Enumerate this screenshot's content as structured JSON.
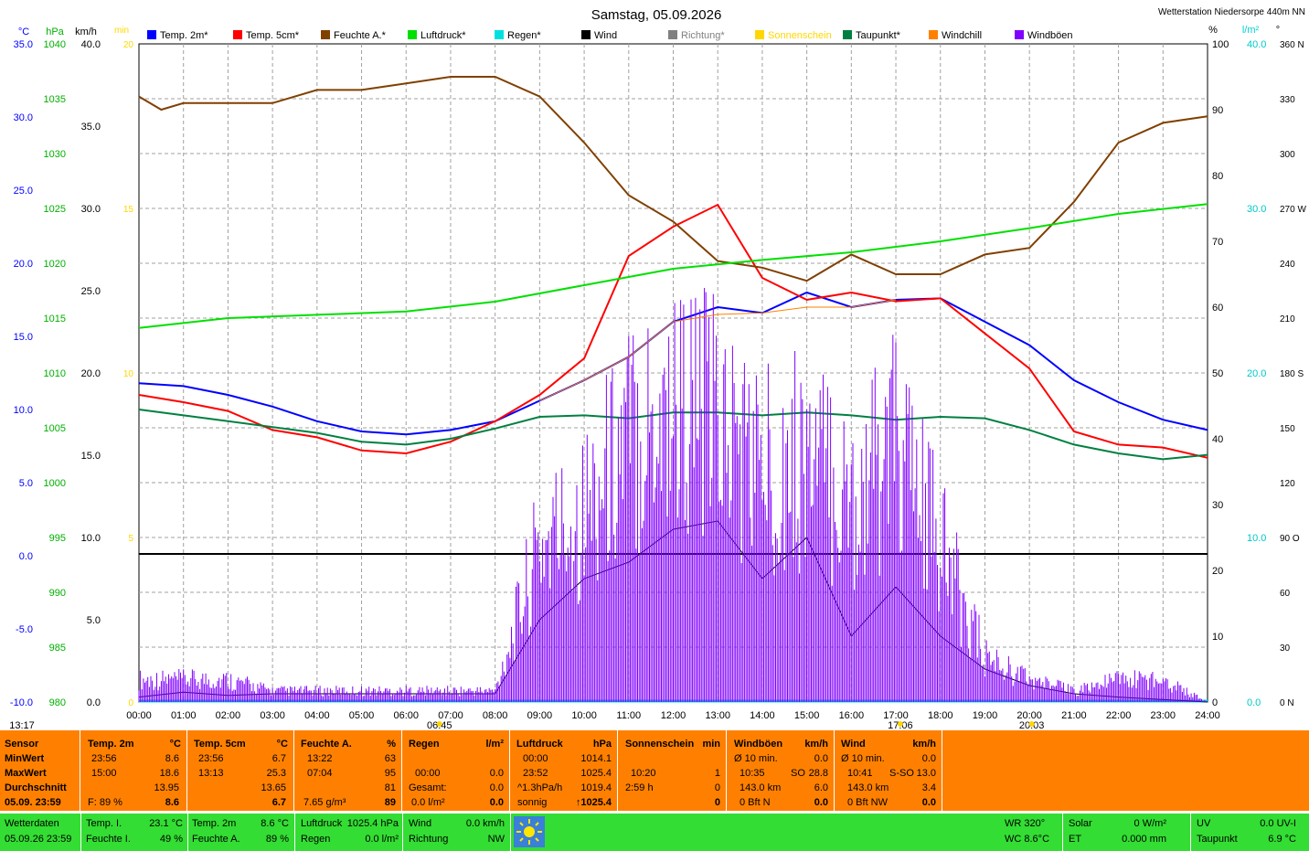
{
  "header": {
    "title": "Samstag, 05.09.2026",
    "station": "Wetterstation Niedersorpe 440m NN"
  },
  "legend": [
    {
      "name": "Temp. 2m*",
      "color": "#0000ff"
    },
    {
      "name": "Temp. 5cm*",
      "color": "#ff0000"
    },
    {
      "name": "Feuchte A.*",
      "color": "#804000"
    },
    {
      "name": "Luftdruck*",
      "color": "#00e000"
    },
    {
      "name": "Regen*",
      "color": "#00e0e0"
    },
    {
      "name": "Wind",
      "color": "#000000"
    },
    {
      "name": "Richtung*",
      "color": "#808080"
    },
    {
      "name": "Sonnenschein",
      "color": "#ffd700"
    },
    {
      "name": "Taupunkt*",
      "color": "#008040"
    },
    {
      "name": "Windchill",
      "color": "#ff8000"
    },
    {
      "name": "Windböen",
      "color": "#8000ff"
    }
  ],
  "axes": {
    "unit_temp": "°C",
    "unit_press": "hPa",
    "unit_wind": "km/h",
    "unit_min": "min",
    "unit_pct": "%",
    "unit_rain": "l/m²",
    "unit_deg": "°",
    "temp": [
      "35.0",
      "30.0",
      "25.0",
      "20.0",
      "15.0",
      "10.0",
      "5.0",
      "0.0",
      "-5.0",
      "-10.0"
    ],
    "press": [
      "1040",
      "1035",
      "1030",
      "1025",
      "1020",
      "1015",
      "1010",
      "1005",
      "1000",
      "995",
      "990",
      "985",
      "980"
    ],
    "wind": [
      "40.0",
      "35.0",
      "30.0",
      "25.0",
      "20.0",
      "15.0",
      "10.0",
      "5.0",
      "0.0"
    ],
    "min": [
      "20",
      "15",
      "10",
      "5",
      "0"
    ],
    "pct": [
      "100",
      "90",
      "80",
      "70",
      "60",
      "50",
      "40",
      "30",
      "20",
      "10",
      "0"
    ],
    "rain": [
      "40.0",
      "30.0",
      "20.0",
      "10.0",
      "0.0"
    ],
    "deg": [
      "360 N",
      "330",
      "300",
      "270 W",
      "240",
      "210",
      "180 S",
      "150",
      "120",
      "90 O",
      "60",
      "30",
      "0 N"
    ],
    "x": [
      "00:00",
      "01:00",
      "02:00",
      "03:00",
      "04:00",
      "05:00",
      "06:00",
      "07:00",
      "08:00",
      "09:00",
      "10:00",
      "11:00",
      "12:00",
      "13:00",
      "14:00",
      "15:00",
      "16:00",
      "17:00",
      "18:00",
      "19:00",
      "20:00",
      "21:00",
      "22:00",
      "23:00",
      "24:00"
    ]
  },
  "markers": [
    {
      "label": "13:17",
      "hour": null
    },
    {
      "label": "06:45",
      "hour": 6.75
    },
    {
      "label": "17:06",
      "hour": 17.1
    },
    {
      "label": "20:03",
      "hour": 20.05
    }
  ],
  "stats": {
    "sensor": {
      "h": "Sensor",
      "min": "MinWert",
      "max": "MaxWert",
      "avg": "Durchschnitt",
      "date": "05.09. 23:59"
    },
    "temp2m": {
      "h": "Temp. 2m",
      "u": "°C",
      "min_t": "23:56",
      "min_v": "8.6",
      "max_t": "15:00",
      "max_v": "18.6",
      "avg": "13.95",
      "now_l": "F: 89 %",
      "now": "8.6"
    },
    "temp5cm": {
      "h": "Temp. 5cm",
      "u": "°C",
      "min_t": "23:56",
      "min_v": "6.7",
      "max_t": "13:13",
      "max_v": "25.3",
      "avg": "13.65",
      "now": "6.7"
    },
    "feuchte": {
      "h": "Feuchte A.",
      "u": "%",
      "min_t": "13:22",
      "min_v": "63",
      "max_t": "07:04",
      "max_v": "95",
      "avg": "81",
      "now_l": "7.65 g/m³",
      "now": "89"
    },
    "regen": {
      "h": "Regen",
      "u": "l/m²",
      "r1_t": "00:00",
      "r1_v": "0.0",
      "r2_l": "Gesamt:",
      "r2_v": "0.0",
      "r3_l": "0.0 l/m²",
      "now": "0.0"
    },
    "luftdruck": {
      "h": "Luftdruck",
      "u": "hPa",
      "min_t": "00:00",
      "min_v": "1014.1",
      "max_t": "23:52",
      "max_v": "1025.4",
      "avg_l": "^1.3hPa/h",
      "avg": "1019.4",
      "now_l": "sonnig",
      "now": "↑1025.4"
    },
    "sonne": {
      "h": "Sonnenschein",
      "u": "min",
      "r1_t": "10:20",
      "r1_v": "1",
      "r2_t": "2:59 h",
      "r2_v": "0",
      "now": "0"
    },
    "boeen": {
      "h": "Windböen",
      "u": "km/h",
      "r1_l": "Ø 10 min.",
      "r1_v": "0.0",
      "r2_t": "10:35",
      "r2_d": "SO",
      "r2_v": "28.8",
      "r3_l": "143.0 km",
      "r3_v": "6.0",
      "r4_l": "0 Bft N",
      "now": "0.0"
    },
    "wind": {
      "h": "Wind",
      "u": "km/h",
      "r1_l": "Ø 10 min.",
      "r1_v": "0.0",
      "r2_t": "10:41",
      "r2_d": "S-SO",
      "r2_v": "13.0",
      "r3_l": "143.0 km",
      "r3_v": "3.4",
      "r4_l": "0 Bft NW",
      "now": "0.0"
    }
  },
  "bottom": {
    "wd_l": "Wetterdaten",
    "wd_v": "05.09.26 23:59",
    "ti_l": "Temp. I.",
    "ti_v": "23.1 °C",
    "fi_l": "Feuchte I.",
    "fi_v": "49 %",
    "t2_l": "Temp. 2m",
    "t2_v": "8.6 °C",
    "fa_l": "Feuchte A.",
    "fa_v": "89 %",
    "ld_l": "Luftdruck",
    "ld_v": "1025.4 hPa",
    "rg_l": "Regen",
    "rg_v": "0.0 l/m²",
    "wi_l": "Wind",
    "wi_v": "0.0 km/h",
    "ri_l": "Richtung",
    "ri_v": "NW",
    "wr": "WR 320°",
    "wc": "WC 8.6°C",
    "so_l": "Solar",
    "so_v": "0 W/m²",
    "et_l": "ET",
    "et_v": "0.000 mm",
    "uv_l": "UV",
    "uv_v": "0.0 UV-I",
    "tp_l": "Taupunkt",
    "tp_v": "6.9 °C",
    "sun_icon": "sun-icon"
  },
  "chart_data": {
    "type": "line",
    "x_range": [
      0,
      24
    ],
    "series": [
      {
        "name": "Temp. 2m*",
        "color": "#0000ff",
        "axis": "°C",
        "points": [
          [
            0,
            11.8
          ],
          [
            1,
            11.6
          ],
          [
            2,
            11.0
          ],
          [
            3,
            10.2
          ],
          [
            4,
            9.2
          ],
          [
            5,
            8.5
          ],
          [
            6,
            8.3
          ],
          [
            7,
            8.6
          ],
          [
            8,
            9.2
          ],
          [
            9,
            10.6
          ],
          [
            10,
            12.0
          ],
          [
            11,
            13.6
          ],
          [
            12,
            16.0
          ],
          [
            13,
            17.0
          ],
          [
            14,
            16.6
          ],
          [
            15,
            18.0
          ],
          [
            16,
            17.0
          ],
          [
            17,
            17.5
          ],
          [
            18,
            17.6
          ],
          [
            19,
            16.0
          ],
          [
            20,
            14.4
          ],
          [
            21,
            12.0
          ],
          [
            22,
            10.5
          ],
          [
            23,
            9.3
          ],
          [
            24,
            8.6
          ]
        ]
      },
      {
        "name": "Temp. 5cm*",
        "color": "#ff0000",
        "axis": "°C",
        "points": [
          [
            0,
            11.0
          ],
          [
            1,
            10.5
          ],
          [
            2,
            9.9
          ],
          [
            3,
            8.6
          ],
          [
            4,
            8.1
          ],
          [
            5,
            7.2
          ],
          [
            6,
            7.0
          ],
          [
            7,
            7.8
          ],
          [
            8,
            9.2
          ],
          [
            9,
            11.0
          ],
          [
            10,
            13.5
          ],
          [
            11,
            20.5
          ],
          [
            12,
            22.5
          ],
          [
            13,
            24.0
          ],
          [
            14,
            19.0
          ],
          [
            15,
            17.5
          ],
          [
            16,
            18.0
          ],
          [
            17,
            17.4
          ],
          [
            18,
            17.6
          ],
          [
            19,
            15.2
          ],
          [
            20,
            12.8
          ],
          [
            21,
            8.5
          ],
          [
            22,
            7.6
          ],
          [
            23,
            7.4
          ],
          [
            24,
            6.7
          ]
        ]
      },
      {
        "name": "Feuchte A.*",
        "color": "#804000",
        "axis": "%",
        "points": [
          [
            0,
            92
          ],
          [
            0.5,
            90
          ],
          [
            1,
            91
          ],
          [
            2,
            91
          ],
          [
            3,
            91
          ],
          [
            4,
            93
          ],
          [
            5,
            93
          ],
          [
            6,
            94
          ],
          [
            7,
            95
          ],
          [
            8,
            95
          ],
          [
            9,
            92
          ],
          [
            10,
            85
          ],
          [
            11,
            77
          ],
          [
            12,
            73
          ],
          [
            13,
            67
          ],
          [
            14,
            66
          ],
          [
            15,
            64
          ],
          [
            16,
            68
          ],
          [
            17,
            65
          ],
          [
            18,
            65
          ],
          [
            19,
            68
          ],
          [
            20,
            69
          ],
          [
            21,
            76
          ],
          [
            22,
            85
          ],
          [
            23,
            88
          ],
          [
            24,
            89
          ]
        ]
      },
      {
        "name": "Luftdruck*",
        "color": "#00e000",
        "axis": "hPa",
        "points": [
          [
            0,
            1014.1
          ],
          [
            2,
            1015.0
          ],
          [
            4,
            1015.3
          ],
          [
            6,
            1015.6
          ],
          [
            8,
            1016.5
          ],
          [
            10,
            1018.0
          ],
          [
            12,
            1019.5
          ],
          [
            14,
            1020.3
          ],
          [
            16,
            1021.0
          ],
          [
            18,
            1022.0
          ],
          [
            20,
            1023.2
          ],
          [
            22,
            1024.5
          ],
          [
            24,
            1025.4
          ]
        ]
      },
      {
        "name": "Taupunkt*",
        "color": "#008040",
        "axis": "°C",
        "points": [
          [
            0,
            10.0
          ],
          [
            2,
            9.2
          ],
          [
            4,
            8.4
          ],
          [
            5,
            7.8
          ],
          [
            6,
            7.6
          ],
          [
            7,
            8.0
          ],
          [
            8,
            8.7
          ],
          [
            9,
            9.5
          ],
          [
            10,
            9.6
          ],
          [
            11,
            9.4
          ],
          [
            12,
            9.8
          ],
          [
            13,
            9.8
          ],
          [
            14,
            9.6
          ],
          [
            15,
            9.8
          ],
          [
            16,
            9.6
          ],
          [
            17,
            9.3
          ],
          [
            18,
            9.5
          ],
          [
            19,
            9.4
          ],
          [
            20,
            8.6
          ],
          [
            21,
            7.6
          ],
          [
            22,
            7.0
          ],
          [
            23,
            6.6
          ],
          [
            24,
            6.9
          ]
        ]
      },
      {
        "name": "Wind",
        "color": "#000000",
        "axis": "km/h",
        "points": [
          [
            0,
            0.3
          ],
          [
            1,
            0.6
          ],
          [
            2,
            0.4
          ],
          [
            3,
            0.5
          ],
          [
            8,
            0.5
          ],
          [
            9,
            5.0
          ],
          [
            10,
            7.5
          ],
          [
            11,
            8.5
          ],
          [
            12,
            10.5
          ],
          [
            13,
            11.0
          ],
          [
            14,
            7.5
          ],
          [
            15,
            10.0
          ],
          [
            16,
            4.0
          ],
          [
            17,
            7.0
          ],
          [
            18,
            4.0
          ],
          [
            19,
            2.0
          ],
          [
            20,
            1.0
          ],
          [
            21,
            0.5
          ],
          [
            22,
            0.3
          ],
          [
            24,
            0
          ]
        ]
      },
      {
        "name": "Windböen",
        "color": "#8000ff",
        "axis": "km/h",
        "points": [
          [
            0,
            2
          ],
          [
            1,
            2
          ],
          [
            2,
            2
          ],
          [
            3,
            1
          ],
          [
            8,
            1
          ],
          [
            9,
            14
          ],
          [
            10,
            17
          ],
          [
            11,
            24
          ],
          [
            12,
            27
          ],
          [
            13,
            25
          ],
          [
            14,
            21
          ],
          [
            15,
            22
          ],
          [
            16,
            18
          ],
          [
            17,
            23
          ],
          [
            18,
            14
          ],
          [
            19,
            4
          ],
          [
            20,
            2
          ],
          [
            21,
            1
          ],
          [
            22,
            2
          ],
          [
            23,
            2
          ],
          [
            24,
            0
          ]
        ]
      },
      {
        "name": "Windchill",
        "color": "#ff8000",
        "axis": "°C",
        "points": [
          [
            9,
            10.6
          ],
          [
            10,
            12.0
          ],
          [
            11,
            13.6
          ],
          [
            12,
            16.0
          ],
          [
            13,
            16.5
          ],
          [
            14,
            16.6
          ],
          [
            15,
            17.0
          ],
          [
            16,
            17.0
          ],
          [
            17,
            17.5
          ]
        ]
      }
    ],
    "reference_lines": [
      {
        "axis": "km/h",
        "value": 9.0,
        "color": "#000000"
      }
    ]
  }
}
